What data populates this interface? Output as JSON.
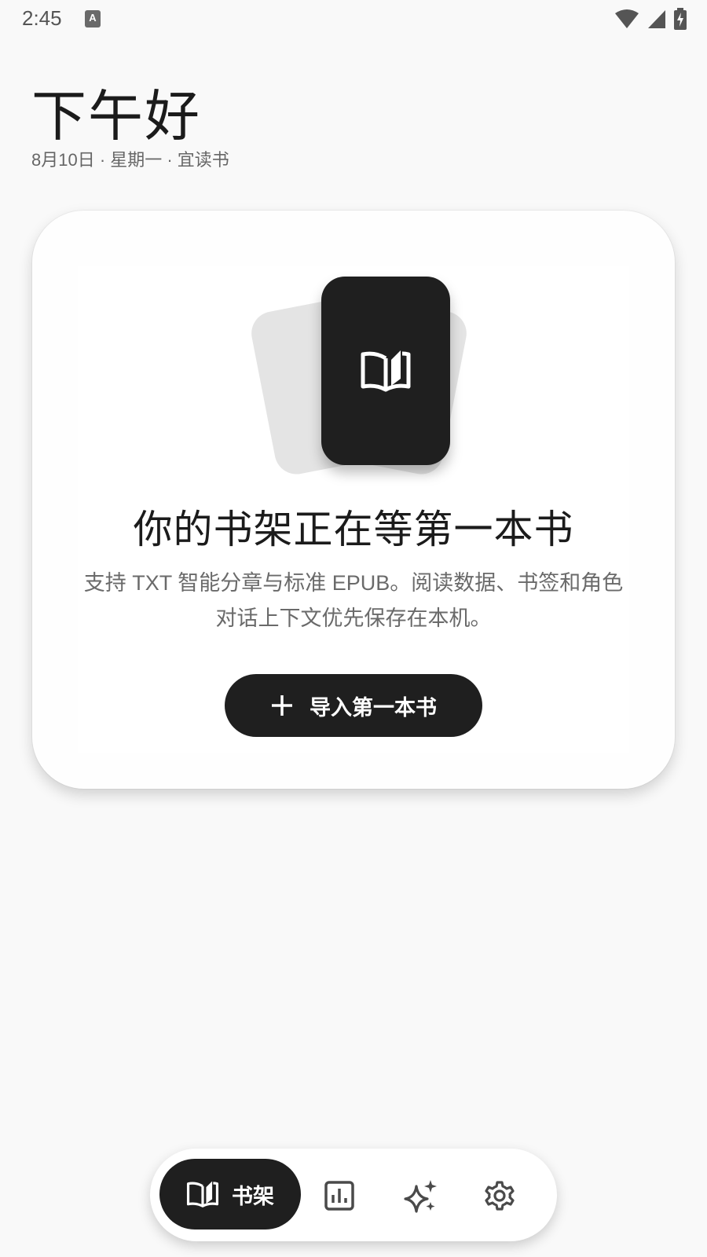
{
  "status_bar": {
    "time": "2:45",
    "notification_icon": "a-notification-icon",
    "icons": [
      "wifi-icon",
      "signal-icon",
      "battery-charging-icon"
    ]
  },
  "header": {
    "greeting": "下午好",
    "subtitle": "8月10日 · 星期一 · 宜读书"
  },
  "empty_state": {
    "icon": "open-book-icon",
    "title": "你的书架正在等第一本书",
    "description": "支持 TXT 智能分章与标准 EPUB。阅读数据、书签和角色对话上下文优先保存在本机。",
    "import_button_label": "导入第一本书",
    "import_button_icon": "plus-icon"
  },
  "bottom_nav": {
    "items": [
      {
        "label": "书架",
        "icon": "open-book-icon",
        "active": true
      },
      {
        "label": "",
        "icon": "stats-icon",
        "active": false
      },
      {
        "label": "",
        "icon": "sparkles-icon",
        "active": false
      },
      {
        "label": "",
        "icon": "gear-icon",
        "active": false
      }
    ]
  },
  "colors": {
    "background": "#f9f9f9",
    "card": "#fefefe",
    "accent_dark": "#1f1f1f",
    "text_secondary": "#6a6a6a"
  }
}
